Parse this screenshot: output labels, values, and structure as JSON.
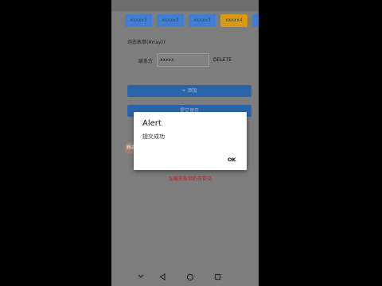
{
  "tabs": [
    {
      "label": "xxxxx1",
      "color": "#3f7ed0"
    },
    {
      "label": "xxxxx2",
      "color": "#3f7ed0"
    },
    {
      "label": "xxxxx3",
      "color": "#3f7ed0"
    },
    {
      "label": "xxxxx4",
      "color": "#d79a10"
    }
  ],
  "form": {
    "section_label": "动态表单(Array)?",
    "field_label": "联系方",
    "field_value": "xxxxx",
    "delete_label": "DELETE",
    "add_button": "+ 添加",
    "submit_button": "提交保存",
    "error_text": "加载失败但仍可提交"
  },
  "float_button": "测试",
  "alert": {
    "title": "Alert",
    "message": "提交成功",
    "ok_label": "OK"
  },
  "colors": {
    "primary": "#2a64a8",
    "warning_tab": "#d79a10",
    "error": "#b02020"
  }
}
